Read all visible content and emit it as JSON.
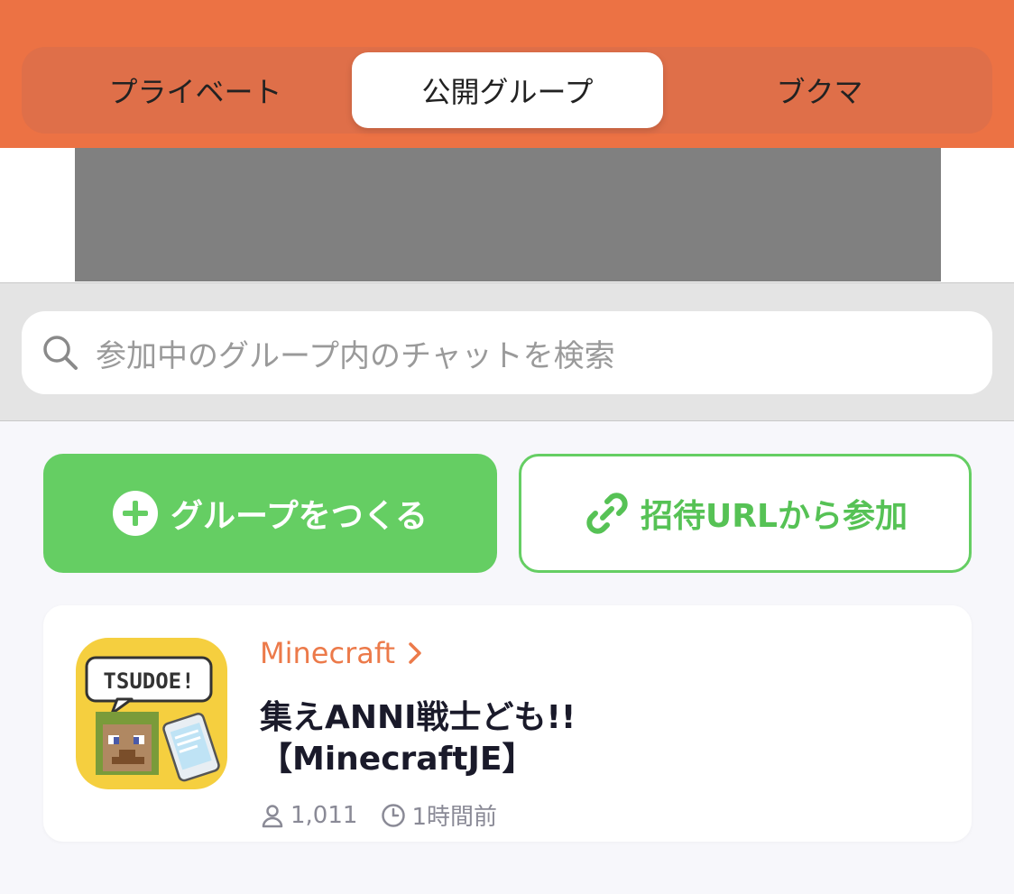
{
  "tabs": {
    "private": "プライベート",
    "public_groups": "公開グループ",
    "bookmarks": "ブクマ",
    "selected": "public_groups"
  },
  "search": {
    "placeholder": "参加中のグループ内のチャットを検索"
  },
  "actions": {
    "create_group": "グループをつくる",
    "join_by_invite": "招待URLから参加"
  },
  "group": {
    "category": "Minecraft",
    "title_line1": "集えANNI戦士ども!!",
    "title_line2": "【MinecraftJE】",
    "member_count": "1,011",
    "last_active": "1時間前",
    "icon_text": "TSUDOE!"
  },
  "colors": {
    "accent": "#ec7244",
    "green": "#65ce63",
    "category": "#ec7a4a"
  }
}
